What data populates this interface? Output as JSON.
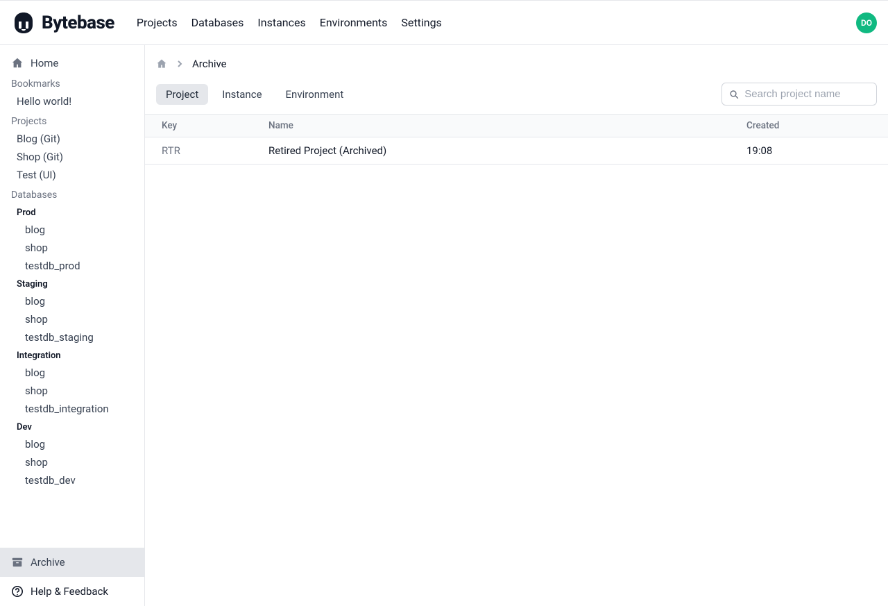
{
  "brand": "Bytebase",
  "avatar_initials": "DO",
  "topnav": {
    "projects": "Projects",
    "databases": "Databases",
    "instances": "Instances",
    "environments": "Environments",
    "settings": "Settings"
  },
  "sidebar": {
    "home": "Home",
    "bookmarks_heading": "Bookmarks",
    "bookmarks": {
      "hello": "Hello world!"
    },
    "projects_heading": "Projects",
    "projects": {
      "blog_git": "Blog (Git)",
      "shop_git": "Shop (Git)",
      "test_ui": "Test (UI)"
    },
    "databases_heading": "Databases",
    "envs": {
      "prod": {
        "label": "Prod",
        "blog": "blog",
        "shop": "shop",
        "testdb": "testdb_prod"
      },
      "staging": {
        "label": "Staging",
        "blog": "blog",
        "shop": "shop",
        "testdb": "testdb_staging"
      },
      "integration": {
        "label": "Integration",
        "blog": "blog",
        "shop": "shop",
        "testdb": "testdb_integration"
      },
      "dev": {
        "label": "Dev",
        "blog": "blog",
        "shop": "shop",
        "testdb": "testdb_dev"
      }
    },
    "archive": "Archive",
    "help": "Help & Feedback"
  },
  "breadcrumb": {
    "current": "Archive"
  },
  "tabs": {
    "project": "Project",
    "instance": "Instance",
    "environment": "Environment"
  },
  "search": {
    "placeholder": "Search project name"
  },
  "table": {
    "header": {
      "key": "Key",
      "name": "Name",
      "created": "Created"
    },
    "rows": [
      {
        "key": "RTR",
        "name": "Retired Project (Archived)",
        "created": "19:08"
      }
    ]
  }
}
